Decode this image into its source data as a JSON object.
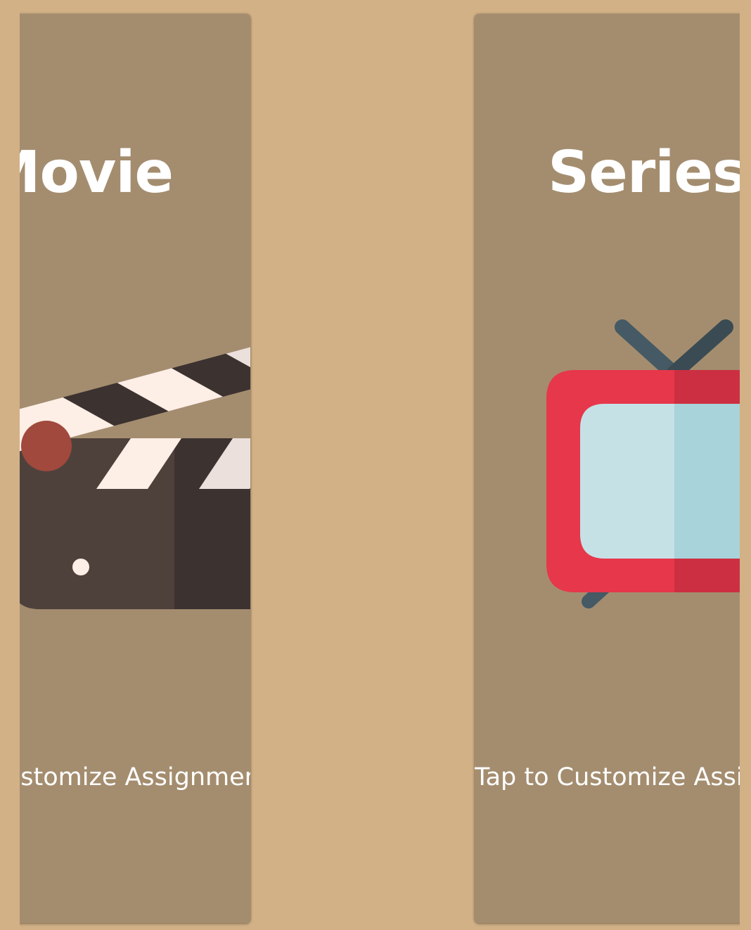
{
  "carousel": {
    "cards": [
      {
        "title": "Movie",
        "caption": "Tap to Customize Assignments",
        "icon": "clapperboard-icon"
      },
      {
        "title": "Series",
        "caption": "Tap to Customize Assignments",
        "icon": "tv-icon"
      }
    ]
  },
  "colors": {
    "background": "#d2b187",
    "card": "#a48d6f",
    "text": "#ffffff",
    "clapper_dark": "#4e413c",
    "clapper_darker": "#3c3230",
    "clapper_light": "#fdeee6",
    "clapper_hinge": "#a0493c",
    "tv_red": "#e6374b",
    "tv_red_dark": "#cc2f42",
    "tv_screen": "#c6e1e6",
    "tv_screen_dark": "#a8d3da",
    "tv_antenna": "#455a64"
  }
}
